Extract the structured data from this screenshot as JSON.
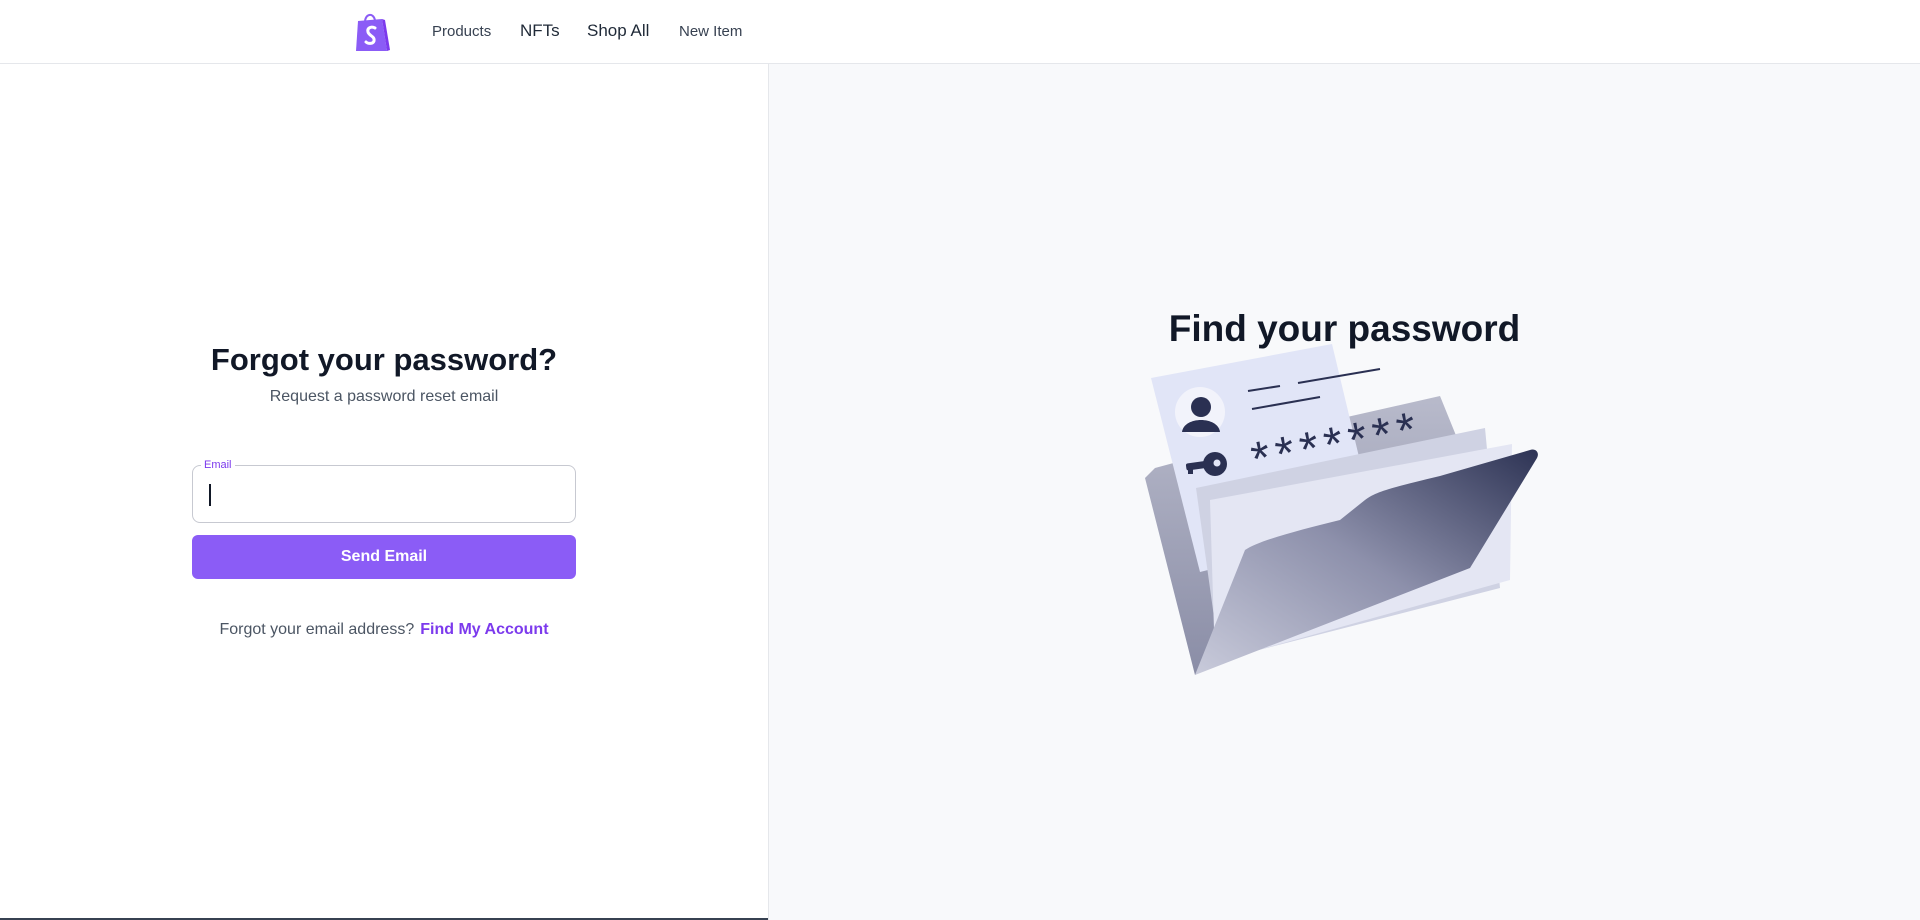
{
  "nav": {
    "logo_icon": "shopping-bag-icon",
    "links": [
      {
        "label": "Products"
      },
      {
        "label": "NFTs"
      },
      {
        "label": "Shop All"
      },
      {
        "label": "New Item"
      }
    ]
  },
  "form": {
    "title": "Forgot your password?",
    "subtitle": "Request a password reset email",
    "email_label": "Email",
    "email_value": "",
    "submit_label": "Send Email",
    "recover_prompt": "Forgot your email address?",
    "recover_link": "Find My Account"
  },
  "illustration": {
    "title": "Find your password",
    "icon": "password-folder-illustration",
    "password_mask": "*******"
  },
  "colors": {
    "accent": "#8b5cf6",
    "text_dark": "#111827",
    "right_panel_bg": "#f8f9fb"
  }
}
